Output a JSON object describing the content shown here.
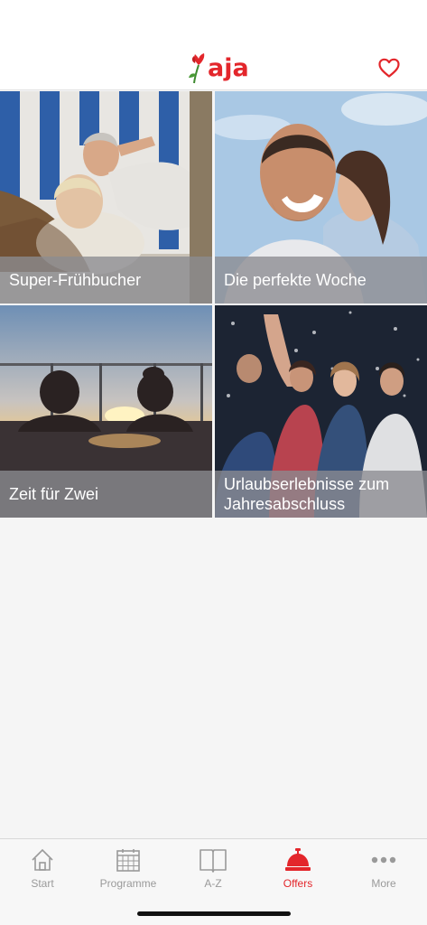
{
  "header": {
    "logo_text": "aja",
    "favorites_icon": "heart-outline-icon",
    "accent_color": "#e3262b"
  },
  "offers": [
    {
      "title": "Super-Frühbucher"
    },
    {
      "title": "Die perfekte Woche"
    },
    {
      "title": "Zeit für Zwei"
    },
    {
      "title": "Urlaubserlebnisse zum Jahresabschluss"
    }
  ],
  "tabbar": {
    "active_tab": "Offers",
    "tabs": [
      {
        "label": "Start",
        "icon": "home-icon"
      },
      {
        "label": "Programme",
        "icon": "calendar-icon"
      },
      {
        "label": "A-Z",
        "icon": "book-icon"
      },
      {
        "label": "Offers",
        "icon": "service-bell-icon"
      },
      {
        "label": "More",
        "icon": "more-dots-icon"
      }
    ]
  }
}
